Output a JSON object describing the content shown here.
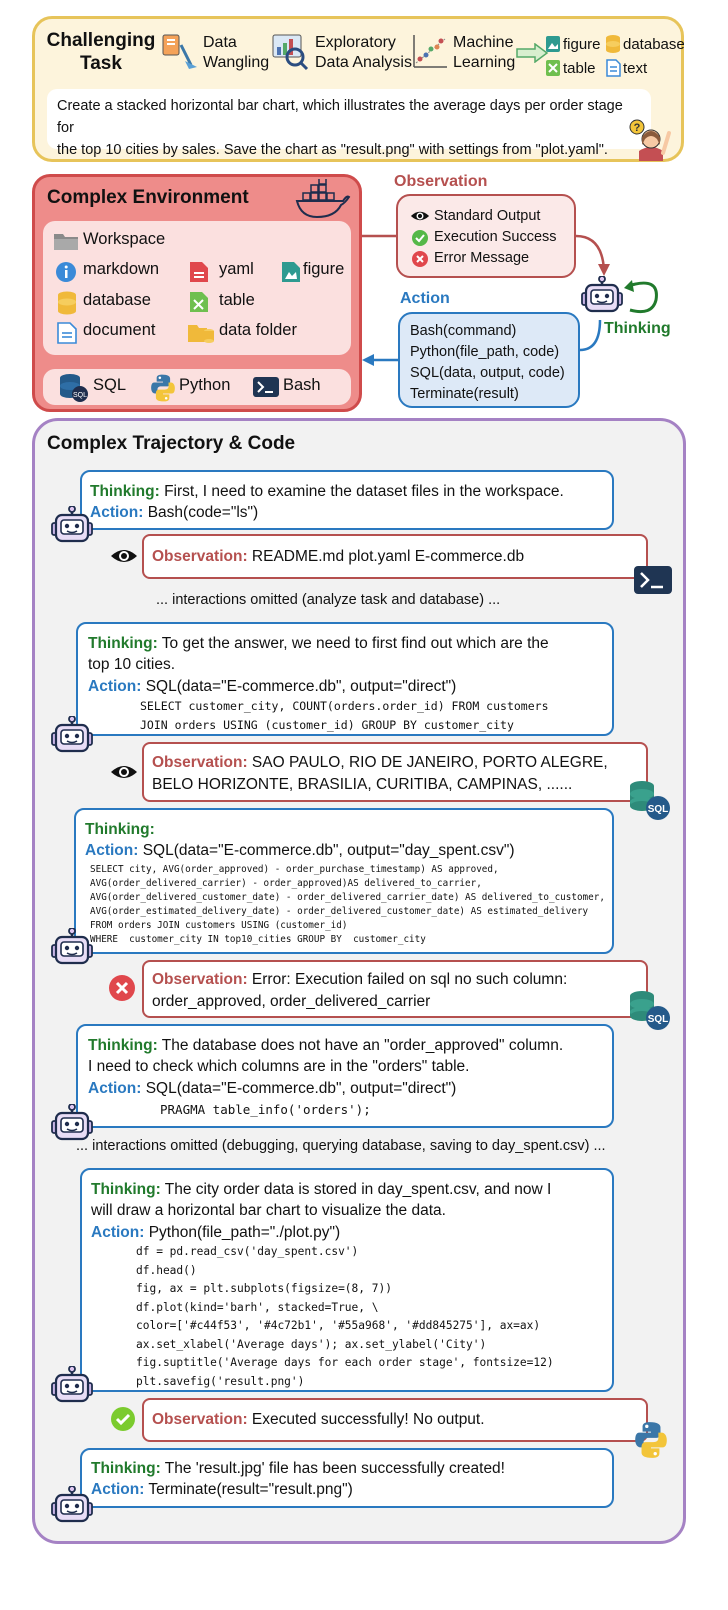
{
  "task": {
    "title_line1": "Challenging",
    "title_line2": "Task",
    "categories": [
      {
        "line1": "Data",
        "line2": "Wangling",
        "icon": "data-wrangling-icon"
      },
      {
        "line1": "Exploratory",
        "line2": "Data Analysis",
        "icon": "data-analysis-icon"
      },
      {
        "line1": "Machine",
        "line2": "Learning",
        "icon": "machine-learning-icon"
      }
    ],
    "outputs": [
      "figure",
      "database",
      "table",
      "text"
    ],
    "description_line1": "Create a stacked horizontal bar chart, which illustrates the average days per order stage for",
    "description_line2": "the top 10 cities by sales. Save the chart as \"result.png\" with settings from \"plot.yaml\"."
  },
  "environment": {
    "title": "Complex Environment",
    "workspace": "Workspace",
    "files": [
      "markdown",
      "yaml",
      "figure",
      "database",
      "table",
      "document",
      "data folder"
    ],
    "tools": [
      "SQL",
      "Python",
      "Bash"
    ]
  },
  "observation": {
    "label": "Observation",
    "items": [
      "Standard Output",
      "Execution Success",
      "Error Message"
    ]
  },
  "action": {
    "label": "Action",
    "items": [
      "Bash(command)",
      "Python(file_path, code)",
      "SQL(data, output, code)",
      "Terminate(result)"
    ]
  },
  "thinking_label": "Thinking",
  "trajectory": {
    "title": "Complex Trajectory & Code",
    "thinking_prefix": "Thinking:",
    "action_prefix": "Action:",
    "observation_prefix": "Observation:",
    "step1": {
      "thinking": "First, I need to examine the dataset files in the workspace.",
      "action": "Bash(code=\"ls\")",
      "observation": "README.md  plot.yaml E-commerce.db"
    },
    "omit1": "... interactions omitted (analyze task and database) ...",
    "step2": {
      "thinking_line1": "To get the answer, we need to first find out which are the",
      "thinking_line2": "top 10 cities.",
      "action": "SQL(data=\"E-commerce.db\", output=\"direct\")",
      "code": [
        "SELECT customer_city, COUNT(orders.order_id) FROM customers",
        "JOIN orders USING (customer_id) GROUP BY customer_city"
      ],
      "observation_line1": "SAO PAULO, RIO DE JANEIRO, PORTO ALEGRE,",
      "observation_line2": "BELO HORIZONTE, BRASILIA, CURITIBA, CAMPINAS, ......"
    },
    "step3": {
      "action": "SQL(data=\"E-commerce.db\", output=\"day_spent.csv\")",
      "code": [
        "SELECT city, AVG(order_approved) - order_purchase_timestamp) AS approved,",
        "AVG(order_delivered_carrier) - order_approved)AS delivered_to_carrier,",
        "AVG(order_delivered_customer_date) - order_delivered_carrier_date) AS delivered_to_customer,",
        "AVG(order_estimated_delivery_date) - order_delivered_customer_date) AS estimated_delivery",
        "FROM orders JOIN customers USING (customer_id)",
        "WHERE  customer_city IN top10_cities GROUP BY  customer_city"
      ],
      "observation_line1": "Error: Execution failed on sql no such column:",
      "observation_line2": "order_approved, order_delivered_carrier"
    },
    "step4": {
      "thinking_line1": "The database does not have an \"order_approved\" column.",
      "thinking_line2": "I need to check which columns are in the \"orders\" table.",
      "action": "SQL(data=\"E-commerce.db\", output=\"direct\")",
      "code": "PRAGMA table_info('orders');"
    },
    "omit2": "... interactions omitted (debugging, querying database, saving to day_spent.csv) ...",
    "step5": {
      "thinking_line1": "The city order data is stored in day_spent.csv, and now I",
      "thinking_line2": "will draw a horizontal bar chart to visualize the data.",
      "action": "Python(file_path=\"./plot.py\")",
      "code": [
        "df = pd.read_csv('day_spent.csv')",
        "df.head()",
        "fig, ax = plt.subplots(figsize=(8, 7))",
        "df.plot(kind='barh', stacked=True, \\",
        "color=['#c44f53', '#4c72b1', '#55a968', '#dd845275'], ax=ax)",
        "ax.set_xlabel('Average days'); ax.set_ylabel('City')",
        "fig.suptitle('Average days for each order stage', fontsize=12)",
        "plt.savefig('result.png')"
      ],
      "observation": "Executed successfully! No output."
    },
    "step6": {
      "thinking": "The 'result.jpg' file has been successfully created!",
      "action": "Terminate(result=\"result.png\")"
    }
  },
  "colors": {
    "thinking": "#217a2c",
    "action": "#2a79c0",
    "observation": "#b5504f",
    "task_border": "#e7c45a",
    "env_border": "#cf4b4b",
    "trajectory_border": "#a582c4"
  }
}
